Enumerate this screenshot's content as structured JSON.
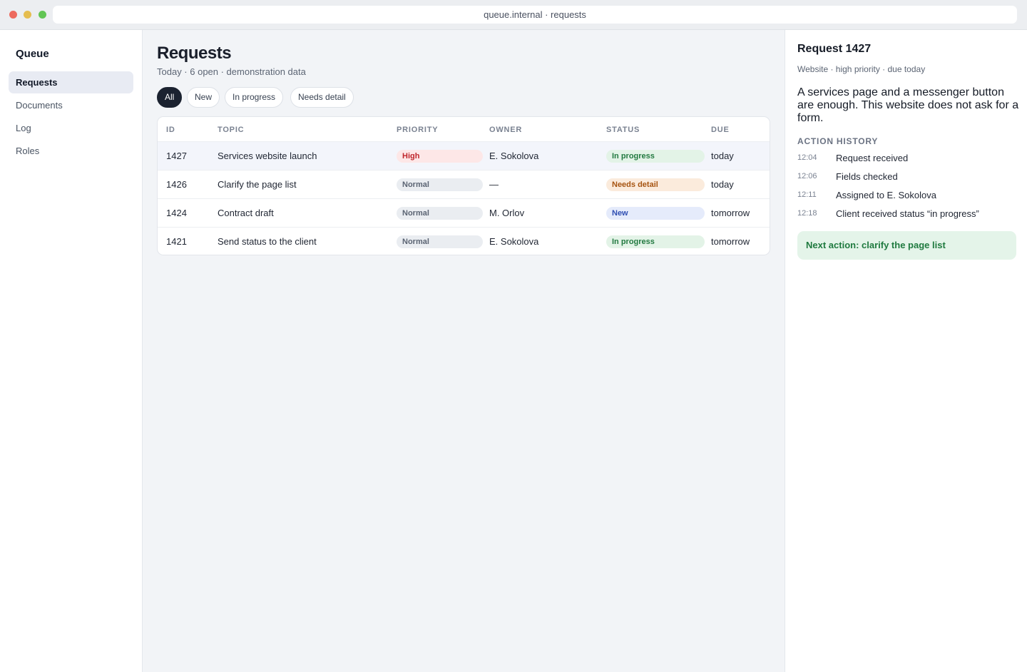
{
  "browser": {
    "address": "queue.internal · requests"
  },
  "sidebar": {
    "brand": "Queue",
    "items": [
      {
        "label": "Requests",
        "active": true
      },
      {
        "label": "Documents",
        "active": false
      },
      {
        "label": "Log",
        "active": false
      },
      {
        "label": "Roles",
        "active": false
      }
    ]
  },
  "main": {
    "title": "Requests",
    "subtitle": "Today · 6 open · demonstration data",
    "filters": [
      {
        "label": "All",
        "active": true
      },
      {
        "label": "New",
        "active": false
      },
      {
        "label": "In progress",
        "active": false
      },
      {
        "label": "Needs detail",
        "active": false
      }
    ],
    "table": {
      "columns": [
        "ID",
        "TOPIC",
        "PRIORITY",
        "OWNER",
        "STATUS",
        "DUE"
      ],
      "rows": [
        {
          "id": "1427",
          "topic": "Services website launch",
          "priority": "High",
          "owner": "E. Sokolova",
          "status": "In progress",
          "due": "today",
          "selected": true
        },
        {
          "id": "1426",
          "topic": "Clarify the page list",
          "priority": "Normal",
          "owner": "—",
          "status": "Needs detail",
          "due": "today"
        },
        {
          "id": "1424",
          "topic": "Contract draft",
          "priority": "Normal",
          "owner": "M. Orlov",
          "status": "New",
          "due": "tomorrow"
        },
        {
          "id": "1421",
          "topic": "Send status to the client",
          "priority": "Normal",
          "owner": "E. Sokolova",
          "status": "In progress",
          "due": "tomorrow"
        }
      ]
    }
  },
  "detail": {
    "title": "Request 1427",
    "meta": "Website · high priority · due today",
    "description": "A services page and a messenger button are enough. This website does not ask for a form.",
    "history_title": "ACTION HISTORY",
    "history": [
      {
        "time": "12:04",
        "text": "Request received"
      },
      {
        "time": "12:06",
        "text": "Fields checked"
      },
      {
        "time": "12:11",
        "text": "Assigned to E. Sokolova"
      },
      {
        "time": "12:18",
        "text": "Client received status “in progress”"
      }
    ],
    "next_action": "Next action: clarify the page list"
  },
  "colors": {
    "accent_dark": "#1b2230",
    "priority_high": "#c0262b",
    "status_in_progress": "#237a41",
    "status_needs_detail": "#a65411",
    "status_new": "#2f4eb2"
  }
}
